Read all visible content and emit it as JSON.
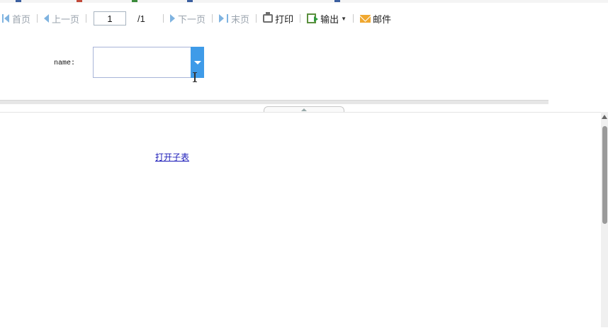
{
  "toolbar": {
    "first_label": "首页",
    "prev_label": "上一页",
    "page_value": "1",
    "page_total": "/1",
    "next_label": "下一页",
    "last_label": "末页",
    "print_label": "打印",
    "export_label": "输出",
    "export_caret": "▼",
    "mail_label": "邮件"
  },
  "params": {
    "name_label": "name:",
    "name_value": ""
  },
  "report": {
    "link_label": "打开子表"
  },
  "colors": {
    "accent": "#3f9be8",
    "link": "#1a1ab8",
    "disabled_text": "#9aa3ad"
  }
}
